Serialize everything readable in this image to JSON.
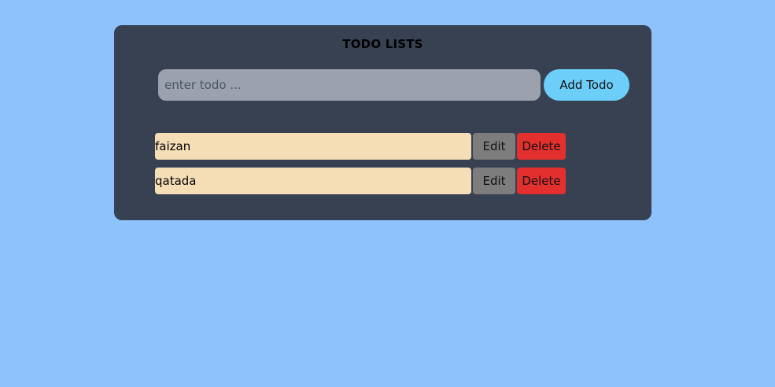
{
  "app": {
    "title": "TODO LISTS"
  },
  "form": {
    "input_value": "",
    "input_placeholder": "enter todo ...",
    "add_label": "Add Todo"
  },
  "todos": [
    {
      "text": "faizan",
      "edit_label": "Edit",
      "delete_label": "Delete"
    },
    {
      "text": "qatada",
      "edit_label": "Edit",
      "delete_label": "Delete"
    }
  ],
  "colors": {
    "background": "#8ec2fd",
    "panel": "#374152",
    "input": "#9ba2ad",
    "add_button": "#6dcefa",
    "todo_item": "#f5deb6",
    "edit_button": "#7d7d7d",
    "delete_button": "#e3302f"
  }
}
